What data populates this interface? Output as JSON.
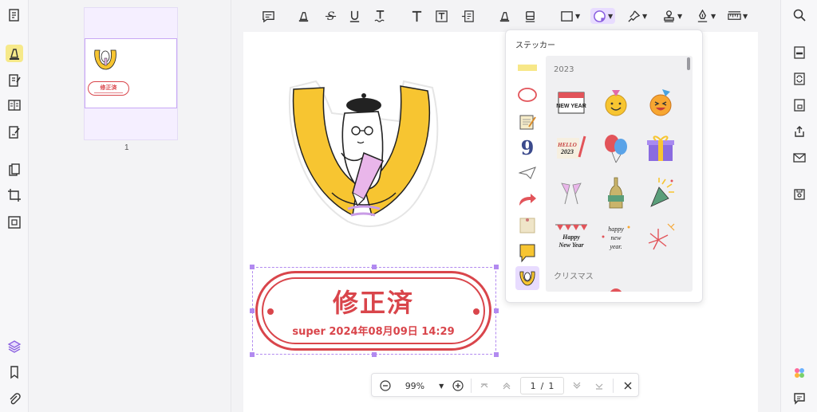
{
  "thumbnail": {
    "page_number": "1",
    "stamp_title": "修正済"
  },
  "popup": {
    "title": "ステッカー",
    "section_2023": "2023",
    "section_christmas": "クリスマス",
    "sticker_9": "9",
    "stickers": [
      {
        "name": "calendar-new-year-sticker",
        "text": "NEW YEAR"
      },
      {
        "name": "party-smiley-sticker"
      },
      {
        "name": "party-laughing-sticker"
      },
      {
        "name": "hello-2023-sticker",
        "text1": "HELLO",
        "text2": "2023"
      },
      {
        "name": "balloons-sticker"
      },
      {
        "name": "gift-box-sticker"
      },
      {
        "name": "champagne-glasses-sticker"
      },
      {
        "name": "champagne-bottle-sticker"
      },
      {
        "name": "party-popper-sticker"
      },
      {
        "name": "happy-new-year-banner-sticker",
        "text1": "Happy",
        "text2": "New Year"
      },
      {
        "name": "happy-new-year-script-sticker",
        "text1": "happy",
        "text2": "new",
        "text3": "year."
      },
      {
        "name": "fireworks-sticker"
      }
    ]
  },
  "stamp": {
    "title": "修正済",
    "subtitle": "super 2024年08月09日 14:29",
    "color": "#d9454b"
  },
  "zoom": {
    "level": "99%",
    "current_page": "1",
    "separator": "/",
    "total_pages": "1"
  },
  "colors": {
    "accent": "#b28af0",
    "highlight": "#f6e98a",
    "stamp_red": "#d9454b"
  }
}
